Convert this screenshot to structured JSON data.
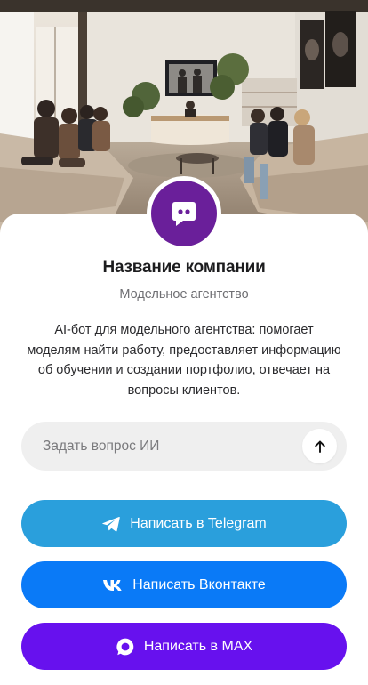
{
  "company": {
    "name": "Название компании",
    "type": "Модельное агентство",
    "description": "AI-бот для модельного агентства: помогает моделям найти работу, предоставляет информацию об обучении и создании портфолио, отвечает на вопросы клиентов."
  },
  "ask": {
    "placeholder": "Задать вопрос ИИ",
    "value": ""
  },
  "buttons": {
    "telegram": "Написать в Telegram",
    "vk": "Написать Вконтакте",
    "max": "Написать в MAX"
  },
  "icons": {
    "avatar": "chat-bot-icon",
    "send": "arrow-up-icon",
    "telegram": "telegram-icon",
    "vk": "vk-icon",
    "max": "max-icon"
  },
  "colors": {
    "avatar_bg": "#6a1f9a",
    "telegram": "#2a9fdc",
    "vk": "#0a7af7",
    "max": "#6711ee",
    "input_bg": "#efefef"
  }
}
